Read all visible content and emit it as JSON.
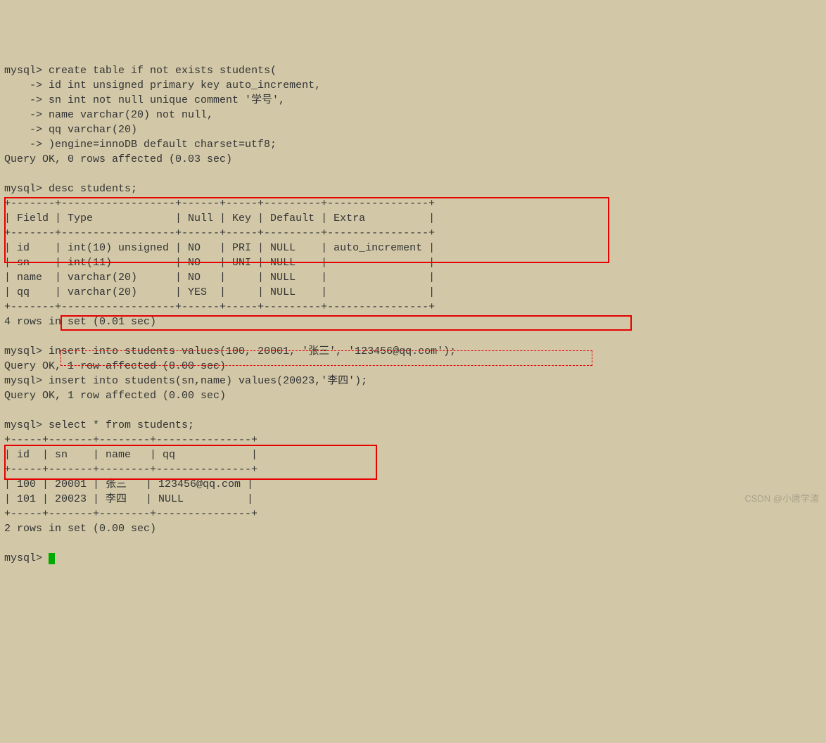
{
  "cmd1": {
    "prompt": "mysql> ",
    "line1": "create table if not exists students(",
    "line2": "    -> id int unsigned primary key auto_increment,",
    "line3": "    -> sn int not null unique comment '学号',",
    "line4": "    -> name varchar(20) not null,",
    "line5": "    -> qq varchar(20)",
    "line6": "    -> )engine=innoDB default charset=utf8;",
    "result": "Query OK, 0 rows affected (0.03 sec)"
  },
  "cmd2": {
    "prompt": "mysql> ",
    "text": "desc students;"
  },
  "desc_table": {
    "border_top": "+-------+------------------+------+-----+---------+----------------+",
    "header": "| Field | Type             | Null | Key | Default | Extra          |",
    "border_mid": "+-------+------------------+------+-----+---------+----------------+",
    "row1": "| id    | int(10) unsigned | NO   | PRI | NULL    | auto_increment |",
    "row2": "| sn    | int(11)          | NO   | UNI | NULL    |                |",
    "row3": "| name  | varchar(20)      | NO   |     | NULL    |                |",
    "row4": "| qq    | varchar(20)      | YES  |     | NULL    |                |",
    "border_bot": "+-------+------------------+------+-----+---------+----------------+",
    "result": "4 rows in set (0.01 sec)"
  },
  "cmd3": {
    "prompt": "mysql> ",
    "text": "insert into students values(100, 20001, '张三', '123456@qq.com');",
    "result": "Query OK, 1 row affected (0.00 sec)"
  },
  "cmd4": {
    "prompt": "mysql> ",
    "text": "insert into students(sn,name) values(20023,'李四');",
    "result": "Query OK, 1 row affected (0.00 sec)"
  },
  "cmd5": {
    "prompt": "mysql> ",
    "text": "select * from students;"
  },
  "select_table": {
    "border_top": "+-----+-------+--------+---------------+",
    "header": "| id  | sn    | name   | qq            |",
    "border_mid": "+-----+-------+--------+---------------+",
    "row1": "| 100 | 20001 | 张三   | 123456@qq.com |",
    "row2": "| 101 | 20023 | 李四   | NULL          |",
    "border_bot": "+-----+-------+--------+---------------+",
    "result": "2 rows in set (0.00 sec)"
  },
  "prompt_end": "mysql> ",
  "watermark": "CSDN @小唐学渣"
}
